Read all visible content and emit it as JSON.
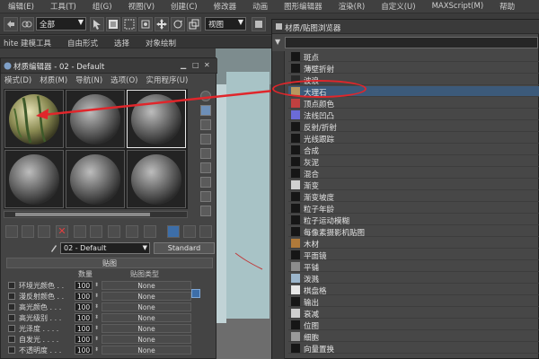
{
  "menubar": {
    "items": [
      "编辑(E)",
      "工具(T)",
      "组(G)",
      "视图(V)",
      "创建(C)",
      "修改器",
      "动画",
      "图形编辑器",
      "渲染(R)",
      "自定义(U)",
      "MAXScript(M)",
      "帮助"
    ]
  },
  "toolbar": {
    "selection_filter": "全部",
    "ref_coord": "视图"
  },
  "ribbon": {
    "tabs": [
      "hite 建模工具",
      "自由形式",
      "选择",
      "对象绘制"
    ]
  },
  "material_editor": {
    "title": "材质编辑器 - 02 - Default",
    "menu": [
      "模式(D)",
      "材质(M)",
      "导航(N)",
      "选项(O)",
      "实用程序(U)"
    ],
    "material_name": "02 - Default",
    "material_type": "Standard",
    "maps_rollout": "贴图",
    "maps_columns": {
      "amount": "数量",
      "map_type": "贴图类型"
    },
    "map_rows": [
      {
        "name": "环境光颜色 . .",
        "amount": "100",
        "map": "None"
      },
      {
        "name": "漫反射颜色 . .",
        "amount": "100",
        "map": "None"
      },
      {
        "name": "高光颜色 . . .",
        "amount": "100",
        "map": "None"
      },
      {
        "name": "高光级别 . . .",
        "amount": "100",
        "map": "None"
      },
      {
        "name": "光泽度 . . . .",
        "amount": "100",
        "map": "None"
      },
      {
        "name": "自发光 . . . .",
        "amount": "100",
        "map": "None"
      },
      {
        "name": "不透明度 . . .",
        "amount": "100",
        "map": "None"
      }
    ]
  },
  "browser": {
    "title": "材质/贴图浏览器",
    "items": [
      {
        "label": "斑点",
        "swatch": "#161616"
      },
      {
        "label": "薄壁折射",
        "swatch": "#161616"
      },
      {
        "label": "波浪",
        "swatch": "#2a2a2a"
      },
      {
        "label": "大理石",
        "swatch": "#b8985e"
      },
      {
        "label": "顶点颜色",
        "swatch": "#c04040"
      },
      {
        "label": "法线凹凸",
        "swatch": "#6b6bd8"
      },
      {
        "label": "反射/折射",
        "swatch": "#161616"
      },
      {
        "label": "光线跟踪",
        "swatch": "#161616"
      },
      {
        "label": "合成",
        "swatch": "#161616"
      },
      {
        "label": "灰泥",
        "swatch": "#161616"
      },
      {
        "label": "混合",
        "swatch": "#161616"
      },
      {
        "label": "渐变",
        "swatch": "#d0d0d0"
      },
      {
        "label": "渐变坡度",
        "swatch": "#161616"
      },
      {
        "label": "粒子年龄",
        "swatch": "#161616"
      },
      {
        "label": "粒子运动模糊",
        "swatch": "#161616"
      },
      {
        "label": "每像素摄影机贴图",
        "swatch": "#161616"
      },
      {
        "label": "木材",
        "swatch": "#b07a3a"
      },
      {
        "label": "平面镜",
        "swatch": "#161616"
      },
      {
        "label": "平铺",
        "swatch": "#8d8d8d"
      },
      {
        "label": "泼溅",
        "swatch": "#9cb6cc"
      },
      {
        "label": "棋盘格",
        "swatch": "#e6e6e6"
      },
      {
        "label": "输出",
        "swatch": "#161616"
      },
      {
        "label": "衰减",
        "swatch": "#cfcfcf"
      },
      {
        "label": "位图",
        "swatch": "#161616"
      },
      {
        "label": "细胞",
        "swatch": "#9a9a9a"
      },
      {
        "label": "向量置换",
        "swatch": "#161616"
      }
    ],
    "highlighted_index": 3
  },
  "colors": {
    "annotation": "#e0262b",
    "highlight": "#3c5a7a"
  }
}
